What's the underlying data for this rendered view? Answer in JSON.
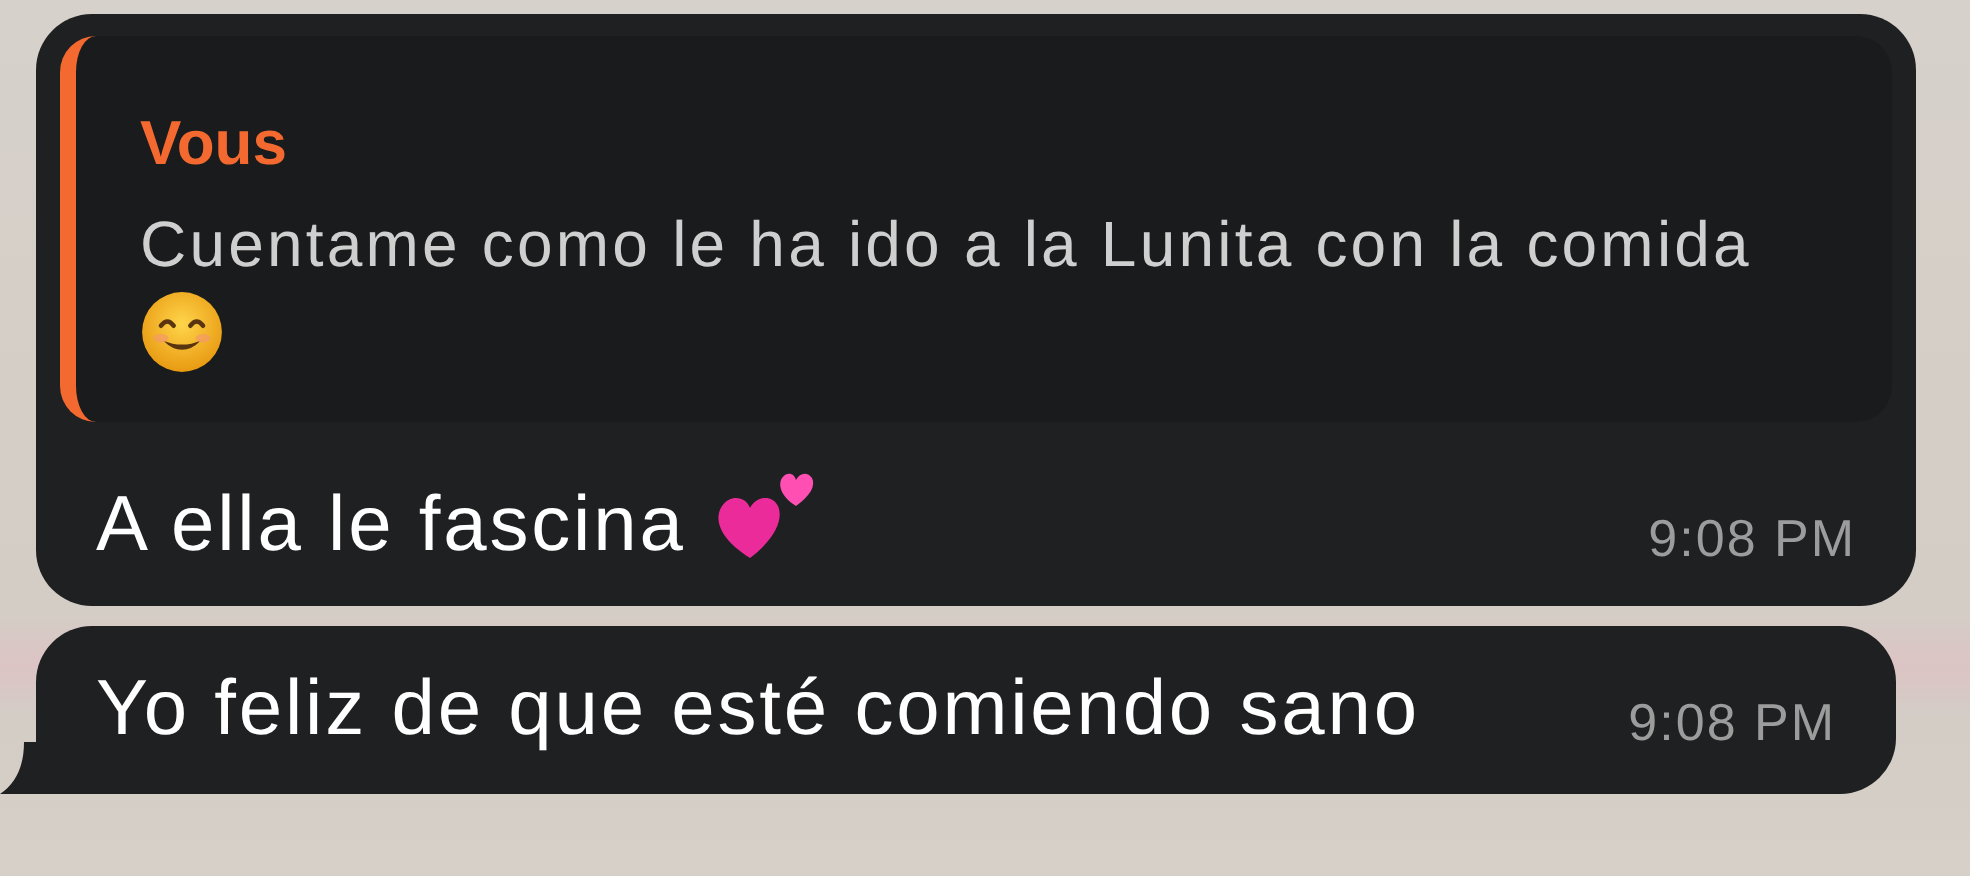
{
  "messages": [
    {
      "reply": {
        "author": "Vous",
        "text": "Cuentame como le ha ido a la Lunita con la comida"
      },
      "text": "A ella le fascina",
      "time": "9:08 PM",
      "tail": false
    },
    {
      "text": "Yo feliz de que esté comiendo sano",
      "time": "9:08 PM",
      "tail": true
    }
  ]
}
